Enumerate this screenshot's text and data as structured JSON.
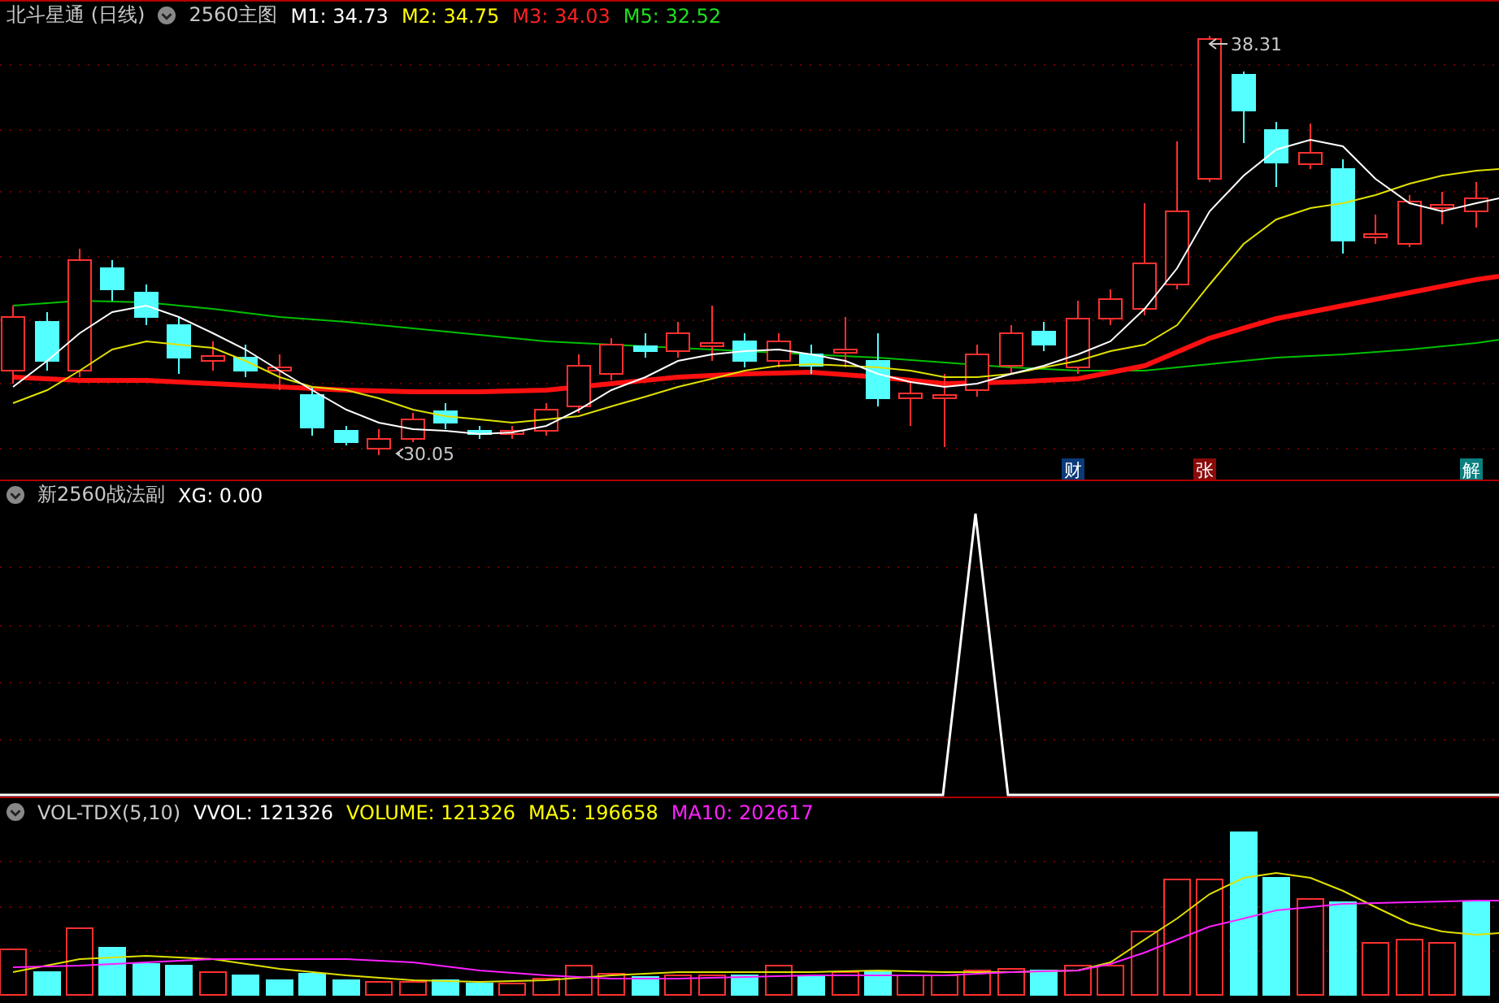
{
  "main_panel": {
    "title": "北斗星通 (日线)",
    "indicator": "2560主图",
    "values": [
      {
        "label": "M1: 34.73",
        "color": "#ffffff"
      },
      {
        "label": "M2: 34.75",
        "color": "#ffff00"
      },
      {
        "label": "M3: 34.03",
        "color": "#ff2020"
      },
      {
        "label": "M5: 32.52",
        "color": "#20e020"
      }
    ],
    "price_labels": [
      {
        "text": "38.31",
        "kind": "high"
      },
      {
        "text": "30.05",
        "kind": "low"
      }
    ],
    "event_tags": [
      {
        "text": "财",
        "color": "#0a3a7a"
      },
      {
        "text": "张",
        "color": "#8a0a0a"
      },
      {
        "text": "解",
        "color": "#0a8080"
      }
    ]
  },
  "sub_panel": {
    "title": "新2560战法副",
    "values": [
      {
        "label": "XG: 0.00",
        "color": "#ffffff"
      }
    ]
  },
  "volume_panel": {
    "title": "VOL-TDX(5,10)",
    "values": [
      {
        "label": "VVOL: 121326",
        "color": "#ffffff"
      },
      {
        "label": "VOLUME: 121326",
        "color": "#ffff00"
      },
      {
        "label": "MA5: 196658",
        "color": "#ffff00"
      },
      {
        "label": "MA10: 202617",
        "color": "#ff20ff"
      }
    ]
  }
}
